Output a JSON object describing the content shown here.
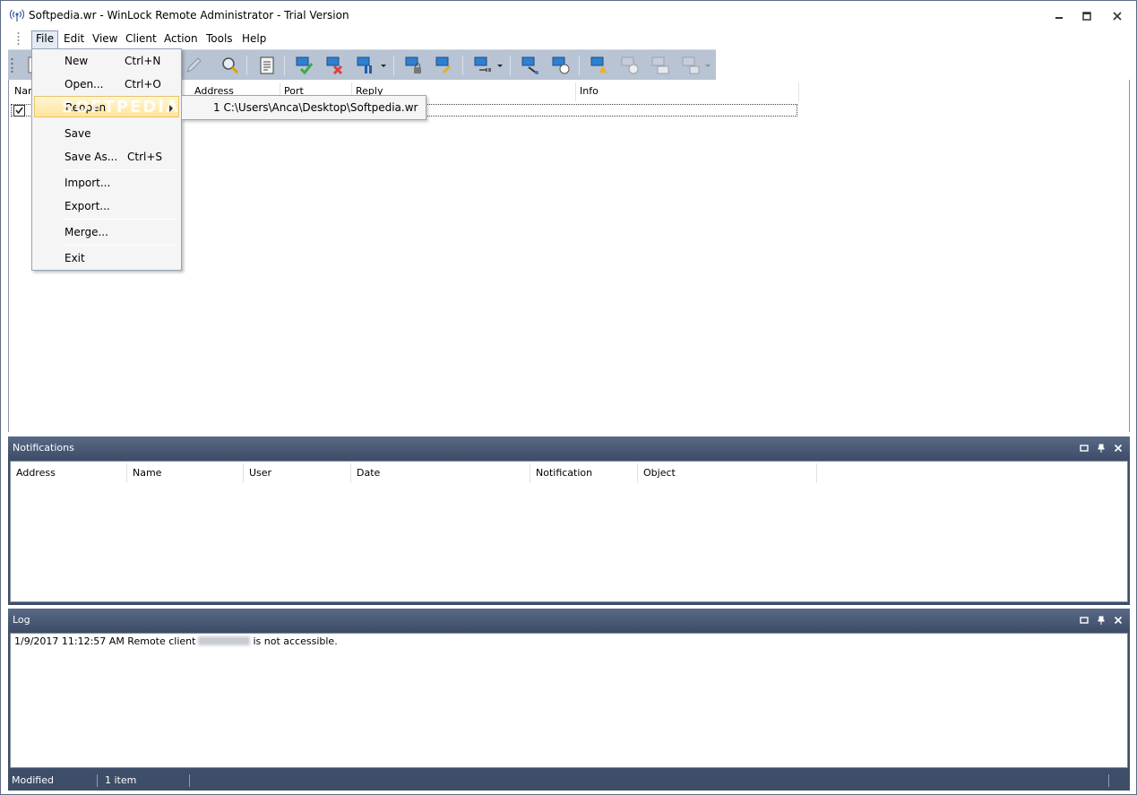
{
  "window": {
    "title": "Softpedia.wr - WinLock Remote Administrator - Trial Version"
  },
  "menubar": {
    "items": [
      "File",
      "Edit",
      "View",
      "Client",
      "Action",
      "Tools",
      "Help"
    ],
    "active": "File"
  },
  "toolbar": {
    "buttons": [
      "new-icon",
      "search-icon",
      "edit-icon",
      "report-icon",
      "client-enable-icon",
      "client-disable-icon",
      "pause-icon",
      "lock-icon",
      "unlock-icon",
      "power-icon",
      "network-icon",
      "message-icon",
      "alert-icon",
      "warning-icon",
      "terminal-icon",
      "screenshot-icon"
    ]
  },
  "main": {
    "columns": [
      "Nam",
      "Address",
      "Port",
      "Reply",
      "Info"
    ],
    "row_checked": true
  },
  "file_menu": {
    "items": [
      {
        "label": "New",
        "shortcut": "Ctrl+N"
      },
      {
        "label": "Open...",
        "shortcut": "Ctrl+O"
      },
      {
        "label": "Reopen",
        "shortcut": ""
      },
      {
        "label": "Save",
        "shortcut": ""
      },
      {
        "label": "Save As...",
        "shortcut": "Ctrl+S"
      },
      {
        "label": "Import...",
        "shortcut": ""
      },
      {
        "label": "Export...",
        "shortcut": ""
      },
      {
        "label": "Merge...",
        "shortcut": ""
      },
      {
        "label": "Exit",
        "shortcut": ""
      }
    ],
    "watermark": "SOFTPEDIA",
    "reopen_submenu": {
      "item": "1 C:\\Users\\Anca\\Desktop\\Softpedia.wr"
    }
  },
  "notifications": {
    "title": "Notifications",
    "columns": [
      "Address",
      "Name",
      "User",
      "Date",
      "Notification",
      "Object"
    ]
  },
  "log": {
    "title": "Log",
    "entry_prefix": "1/9/2017 11:12:57 AM Remote client",
    "entry_suffix": "is not accessible."
  },
  "statusbar": {
    "state": "Modified",
    "count": "1 item"
  },
  "colors": {
    "panel_bg": "#3e4d68",
    "toolbar_bg": "#b8c3d3",
    "menu_highlight": "#ffe59a"
  }
}
